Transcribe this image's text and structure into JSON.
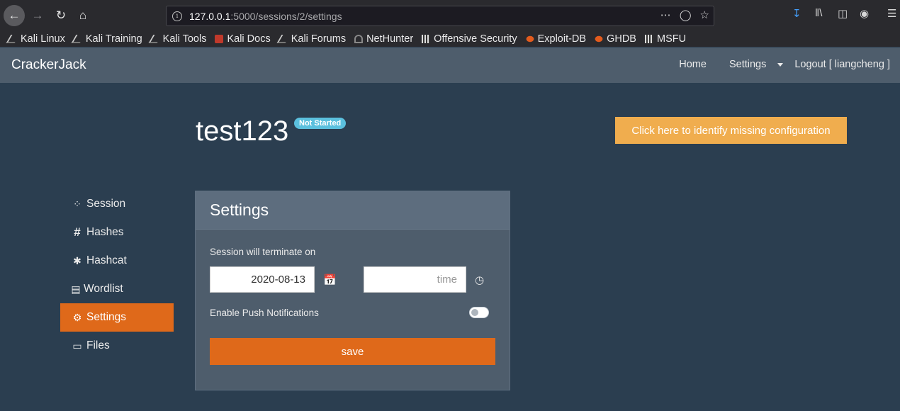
{
  "browser": {
    "url_host": "127.0.0.1",
    "url_path": ":5000/sessions/2/settings",
    "bookmarks": [
      {
        "label": "Kali Linux",
        "icon": "kali-dragon-icon"
      },
      {
        "label": "Kali Training",
        "icon": "kali-dragon-icon"
      },
      {
        "label": "Kali Tools",
        "icon": "kali-dragon-icon"
      },
      {
        "label": "Kali Docs",
        "icon": "kali-docs-icon"
      },
      {
        "label": "Kali Forums",
        "icon": "kali-dragon-icon"
      },
      {
        "label": "NetHunter",
        "icon": "nethunter-icon"
      },
      {
        "label": "Offensive Security",
        "icon": "offsec-icon"
      },
      {
        "label": "Exploit-DB",
        "icon": "exploitdb-icon"
      },
      {
        "label": "GHDB",
        "icon": "exploitdb-icon"
      },
      {
        "label": "MSFU",
        "icon": "offsec-icon"
      }
    ]
  },
  "navbar": {
    "brand": "CrackerJack",
    "home": "Home",
    "settings": "Settings",
    "logout": "Logout [ liangcheng ]"
  },
  "session": {
    "name": "test123",
    "status": "Not Started",
    "config_button": "Click here to identify missing configuration"
  },
  "sidebar": {
    "items": [
      {
        "label": "Session",
        "icon": "spinner-icon"
      },
      {
        "label": "Hashes",
        "icon": "hashtag-icon"
      },
      {
        "label": "Hashcat",
        "icon": "cat-icon"
      },
      {
        "label": "Wordlist",
        "icon": "file-icon"
      },
      {
        "label": "Settings",
        "icon": "gear-icon",
        "active": true
      },
      {
        "label": "Files",
        "icon": "folder-open-icon"
      }
    ]
  },
  "settings_card": {
    "title": "Settings",
    "terminate_label": "Session will terminate on",
    "date_value": "2020-08-13",
    "time_placeholder": "time",
    "push_label": "Enable Push Notifications",
    "push_enabled": false,
    "save_label": "save"
  },
  "colors": {
    "background": "#2b3e50",
    "navbar": "#4e5d6c",
    "accent": "#df691a",
    "warning": "#f0ad4e",
    "info": "#5bc0de"
  }
}
